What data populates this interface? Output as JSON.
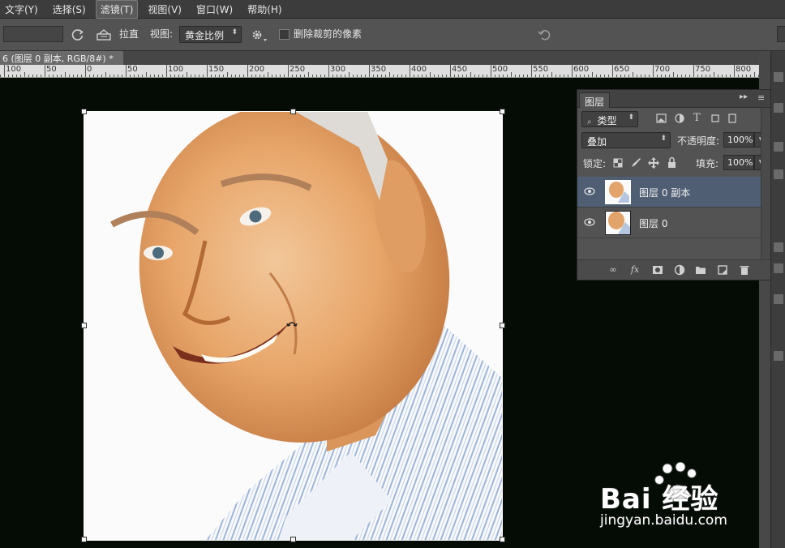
{
  "menu": {
    "items": [
      "文字(Y)",
      "选择(S)",
      "滤镜(T)",
      "视图(V)",
      "窗口(W)",
      "帮助(H)"
    ],
    "active_index": 2
  },
  "options": {
    "straighten_label": "拉直",
    "view_label": "视图:",
    "view_value": "黄金比例",
    "delete_pixels_label": "删除裁剪的像素"
  },
  "document": {
    "tab_title": "(图层 0 副本, RGB/8#) *",
    "tab_close": "×",
    "tab_prefix": "6"
  },
  "ruler": {
    "labels": [
      "100",
      "50",
      "0",
      "50",
      "100",
      "150",
      "200",
      "250",
      "300",
      "350",
      "400",
      "450",
      "500",
      "550",
      "600",
      "650",
      "700",
      "750",
      "800"
    ]
  },
  "layers_panel": {
    "tab_label": "图层",
    "filter_kind": "类型",
    "blend_mode": "叠加",
    "opacity_label": "不透明度:",
    "opacity_value": "100%",
    "lock_label": "锁定:",
    "fill_label": "填充:",
    "fill_value": "100%",
    "layers": [
      {
        "name": "图层 0 副本",
        "selected": true
      },
      {
        "name": "图层 0",
        "selected": false
      }
    ]
  },
  "watermark": {
    "brand": "Bai 经验",
    "url": "jingyan.baidu.com"
  },
  "colors": {
    "canvas_bg": "#040c05",
    "selection": "#4f5e73",
    "panel_bg": "#535353",
    "menubar_bg": "#3c3c3c"
  }
}
